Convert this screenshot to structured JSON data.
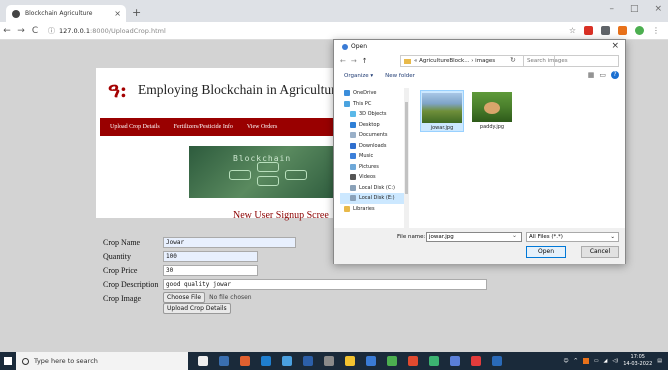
{
  "browser": {
    "tab_title": "Blockchain Agriculture",
    "tab_close": "×",
    "new_tab": "+",
    "url_host": "127.0.0.1",
    "url_path": ":8000/UploadCrop.html",
    "window_controls": [
      "–",
      "□",
      "×"
    ]
  },
  "site": {
    "logo_glyph": "ዓ:",
    "title": "Employing Blockchain in Agriculture",
    "nav": [
      "Upload Crop Details",
      "Fertilizers/Pesticide Info",
      "View Orders"
    ],
    "banner_text": "Blockchain",
    "heading": "New User Signup Scree"
  },
  "form": {
    "crop_name_label": "Crop Name",
    "crop_name_value": "Jowar",
    "quantity_label": "Quantity",
    "quantity_value": "100",
    "price_label": "Crop Price",
    "price_value": "30",
    "description_label": "Crop Description",
    "description_value": "good quality jowar",
    "image_label": "Crop Image",
    "choose_file": "Choose File",
    "no_file": "No file chosen",
    "upload_button": "Upload Crop Details"
  },
  "dialog": {
    "title": "Open",
    "close": "×",
    "path": "« AgricultureBlock... › images",
    "search_placeholder": "Search images",
    "organize": "Organize ▾",
    "new_folder": "New folder",
    "nav_items": [
      {
        "label": "OneDrive",
        "color": "#3b8edb",
        "sub": false,
        "selected": false
      },
      {
        "label": "This PC",
        "color": "#4aa3df",
        "sub": false,
        "selected": false
      },
      {
        "label": "3D Objects",
        "color": "#5bb8e8",
        "sub": true,
        "selected": false
      },
      {
        "label": "Desktop",
        "color": "#2e7fd6",
        "sub": true,
        "selected": false
      },
      {
        "label": "Documents",
        "color": "#9ab0c8",
        "sub": true,
        "selected": false
      },
      {
        "label": "Downloads",
        "color": "#2f6fce",
        "sub": true,
        "selected": false
      },
      {
        "label": "Music",
        "color": "#3c7fd9",
        "sub": true,
        "selected": false
      },
      {
        "label": "Pictures",
        "color": "#6ea8d8",
        "sub": true,
        "selected": false
      },
      {
        "label": "Videos",
        "color": "#555555",
        "sub": true,
        "selected": false
      },
      {
        "label": "Local Disk (C:)",
        "color": "#8aa1b8",
        "sub": true,
        "selected": false
      },
      {
        "label": "Local Disk (E:)",
        "color": "#8aa1b8",
        "sub": true,
        "selected": true
      },
      {
        "label": "Libraries",
        "color": "#e8b94a",
        "sub": false,
        "selected": false
      }
    ],
    "files": [
      {
        "name": "jowar.jpg",
        "selected": true
      },
      {
        "name": "paddy.jpg",
        "selected": false
      }
    ],
    "filename_label": "File name:",
    "filename_value": "jowar.jpg",
    "filetype_value": "All Files (*.*)",
    "open_button": "Open",
    "cancel_button": "Cancel"
  },
  "taskbar": {
    "search_text": "Type here to search",
    "time": "17:05",
    "date": "14-03-2022"
  }
}
